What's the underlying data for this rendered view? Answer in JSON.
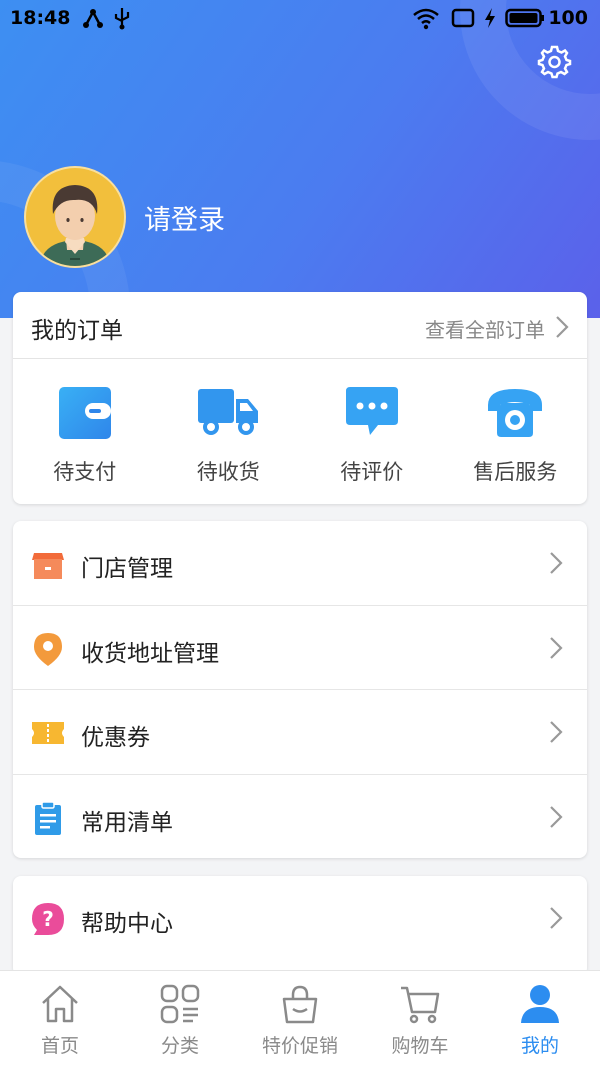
{
  "status_bar": {
    "time": "18:48",
    "battery": "100"
  },
  "profile": {
    "login_text": "请登录"
  },
  "orders": {
    "title": "我的订单",
    "view_all": "查看全部订单",
    "items": [
      {
        "label": "待支付",
        "icon": "wallet-icon"
      },
      {
        "label": "待收货",
        "icon": "truck-icon"
      },
      {
        "label": "待评价",
        "icon": "comment-icon"
      },
      {
        "label": "售后服务",
        "icon": "phone-icon"
      }
    ]
  },
  "menu": {
    "items": [
      {
        "label": "门店管理",
        "icon": "store-icon"
      },
      {
        "label": "收货地址管理",
        "icon": "location-pin-icon"
      },
      {
        "label": "优惠券",
        "icon": "coupon-icon"
      },
      {
        "label": "常用清单",
        "icon": "clipboard-icon"
      }
    ]
  },
  "help": {
    "label": "帮助中心",
    "icon": "help-icon"
  },
  "tabbar": {
    "items": [
      {
        "label": "首页",
        "icon": "home-icon"
      },
      {
        "label": "分类",
        "icon": "category-icon"
      },
      {
        "label": "特价促销",
        "icon": "bag-icon"
      },
      {
        "label": "购物车",
        "icon": "cart-icon"
      },
      {
        "label": "我的",
        "icon": "user-icon"
      }
    ],
    "active_index": 4
  },
  "colors": {
    "accent": "#2c8df0",
    "header_start": "#3d8ff2",
    "header_end": "#5b61ea"
  }
}
